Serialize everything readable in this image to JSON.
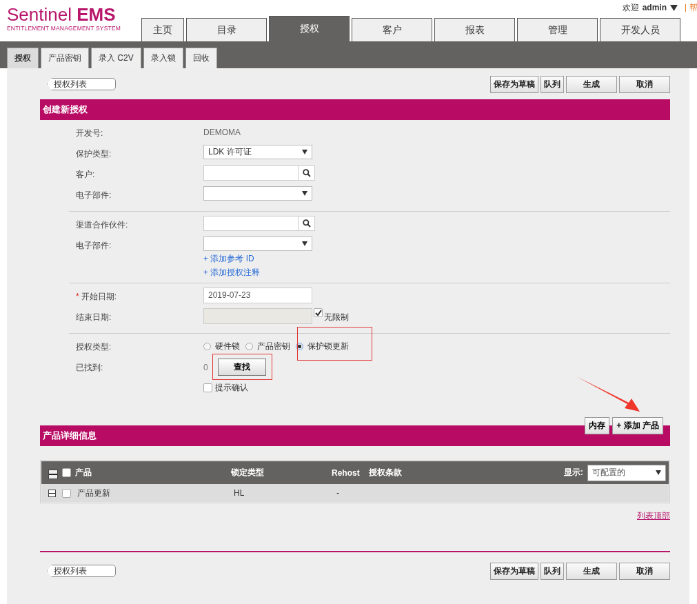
{
  "header": {
    "logo_light": "Sentinel",
    "logo_bold": "EMS",
    "logo_subtitle": "ENTITLEMENT MANAGEMENT SYSTEM",
    "greeting": "欢迎",
    "user": "admin",
    "help": "帮"
  },
  "main_tabs": [
    {
      "label": "主页",
      "selected": false
    },
    {
      "label": "目录",
      "selected": false
    },
    {
      "label": "授权",
      "selected": true
    },
    {
      "label": "客户",
      "selected": false
    },
    {
      "label": "报表",
      "selected": false
    },
    {
      "label": "管理",
      "selected": false
    },
    {
      "label": "开发人员",
      "selected": false
    }
  ],
  "sub_tabs": [
    {
      "label": "授权",
      "selected": true
    },
    {
      "label": "产品密钥",
      "selected": false
    },
    {
      "label": "录入 C2V",
      "selected": false
    },
    {
      "label": "录入锁",
      "selected": false
    },
    {
      "label": "回收",
      "selected": false
    }
  ],
  "top_toolbar": {
    "back": "授权列表",
    "buttons": [
      "保存为草稿",
      "队列",
      "生成",
      "取消"
    ]
  },
  "form": {
    "title": "创建新授权",
    "groups": [
      {
        "rows": [
          {
            "kind": "text",
            "label": "开发号:",
            "value": "DEMOMA"
          },
          {
            "kind": "select",
            "label": "保护类型:",
            "value": "LDK 许可证"
          },
          {
            "kind": "search",
            "label": "客户:"
          },
          {
            "kind": "select",
            "label": "电子部件:"
          }
        ]
      },
      {
        "rows": [
          {
            "kind": "search",
            "label": "渠道合作伙件:"
          },
          {
            "kind": "select",
            "label": "电子部件:",
            "links": [
              "+ 添加参考 ID",
              "+ 添加授权注释"
            ]
          }
        ]
      },
      {
        "rows": [
          {
            "kind": "date",
            "label": "开始日期:",
            "required_mark": "*",
            "value": "2019-07-23"
          },
          {
            "kind": "date",
            "label": "结束日期:",
            "disabled": true,
            "checkbox": {
              "label": "无限制",
              "checked": true
            }
          }
        ]
      },
      {
        "rows": [
          {
            "kind": "radio",
            "label": "授权类型:",
            "options": [
              {
                "label": "硬件锁",
                "selected": false
              },
              {
                "label": "产品密钥",
                "selected": false
              },
              {
                "label": "保护锁更新",
                "selected": true
              }
            ]
          },
          {
            "kind": "found",
            "label": "已找到:",
            "value": "0",
            "button": "查找",
            "checkbox": {
              "label": "提示确认",
              "checked": false
            }
          }
        ]
      }
    ]
  },
  "products": {
    "title": "产品详细信息",
    "buttons": [
      "内存",
      "+ 添加 产品"
    ],
    "columns": [
      "产品",
      "锁定类型",
      "Rehost",
      "授权条款"
    ],
    "header_checked": false,
    "display_label": "显示:",
    "display_value": "可配置的",
    "rows": [
      {
        "checked": false,
        "cells": [
          "产品更新",
          "HL",
          "-"
        ]
      }
    ],
    "top_link": "列表顶部"
  },
  "bottom_toolbar": {
    "back": "授权列表",
    "buttons": [
      "保存为草稿",
      "队列",
      "生成",
      "取消"
    ]
  }
}
